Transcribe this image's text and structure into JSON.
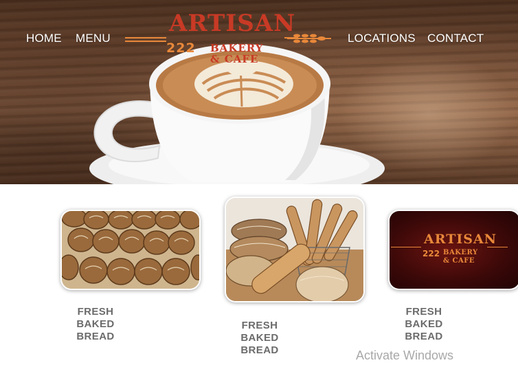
{
  "nav": {
    "home": "HOME",
    "menu": "MENU",
    "locations": "LOCATIONS",
    "contact": "CONTACT"
  },
  "logo": {
    "word": "ARTISAN",
    "number": "222",
    "bakery": "BAKERY",
    "cafe": "& CAFE"
  },
  "cards": [
    {
      "caption": [
        "FRESH",
        "BAKED",
        "BREAD"
      ]
    },
    {
      "caption": [
        "FRESH",
        "BAKED",
        "BREAD"
      ]
    },
    {
      "caption": [
        "FRESH",
        "BAKED",
        "BREAD"
      ]
    }
  ],
  "card_logo": {
    "word": "ARTISAN",
    "number": "222",
    "bakery": "BAKERY",
    "cafe": "& CAFE"
  },
  "watermark": "Activate Windows",
  "colors": {
    "brand_red": "#c83a25",
    "brand_orange": "#e8883a",
    "caption_gray": "#6b6b6b",
    "nav_white": "#ffffff"
  }
}
